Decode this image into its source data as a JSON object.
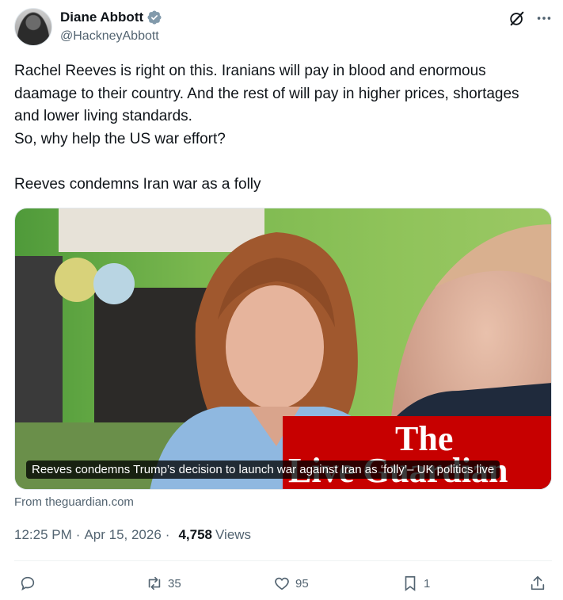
{
  "author": {
    "display_name": "Diane Abbott",
    "handle": "@HackneyAbbott"
  },
  "tweet": {
    "text": "Rachel Reeves is right on this. Iranians will pay in blood and enormous daamage to their country. And the rest of will pay in higher prices, shortages and lower living standards.\nSo, why help the US war effort?\n\nReeves condemns Iran war as a folly"
  },
  "card": {
    "caption": "Reeves condemns Trump’s decision to launch war against Iran as ‘folly’– UK politics live",
    "source": "From theguardian.com",
    "logo_text_top": "The",
    "logo_text_bottom": "Live Guardian"
  },
  "meta": {
    "time": "12:25 PM",
    "separator": "·",
    "date": "Apr 15, 2026",
    "views_count": "4,758",
    "views_label": "Views"
  },
  "actions": {
    "reply_count": "",
    "retweet_count": "35",
    "like_count": "95",
    "bookmark_count": "1"
  },
  "colors": {
    "text_primary": "#0f1419",
    "text_secondary": "#536471",
    "verified": "#829aab",
    "guardian_red": "#c70000"
  },
  "icons": [
    "verified-badge-icon",
    "grok-icon",
    "more-icon",
    "reply-icon",
    "retweet-icon",
    "like-icon",
    "bookmark-icon",
    "share-icon"
  ]
}
